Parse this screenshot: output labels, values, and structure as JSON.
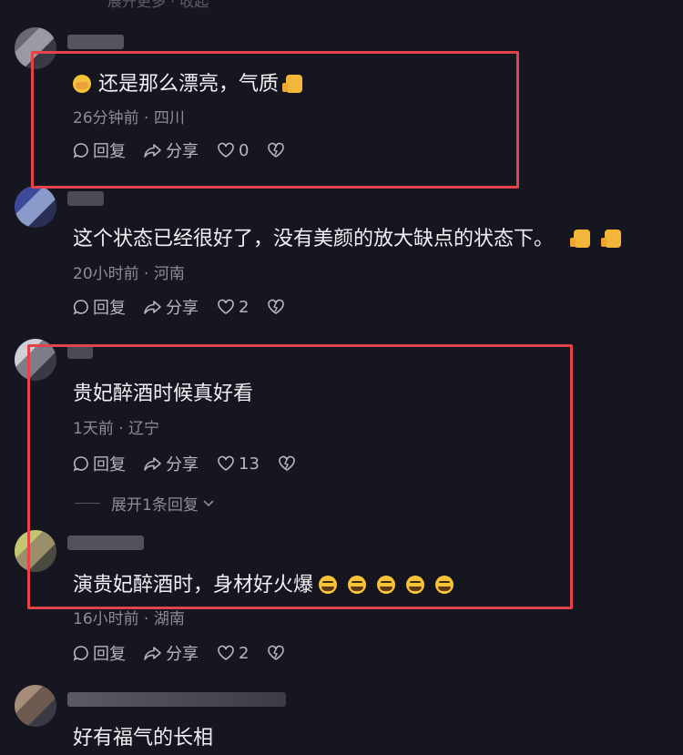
{
  "top_faded": "展开更多 · 收起",
  "comments": [
    {
      "text": "还是那么漂亮，气质",
      "meta": "26分钟前 · 四川",
      "reply": "回复",
      "share": "分享",
      "likes": "0",
      "emoji": [
        "cover-face-icon",
        "thumbs-up-icon"
      ]
    },
    {
      "text": "这个状态已经很好了，没有美颜的放大缺点的状态下。",
      "meta": "20小时前 · 河南",
      "reply": "回复",
      "share": "分享",
      "likes": "2",
      "emoji": [
        "thumbs-up-icon",
        "thumbs-up-icon"
      ]
    },
    {
      "text": "贵妃醉酒时候真好看",
      "meta": "1天前 · 辽宁",
      "reply": "回复",
      "share": "分享",
      "likes": "13",
      "expand": "展开1条回复"
    },
    {
      "text": "演贵妃醉酒时，身材好火爆",
      "meta": "16小时前 · 湖南",
      "reply": "回复",
      "share": "分享",
      "likes": "2",
      "emoji": [
        "crying-laughing-icon",
        "crying-laughing-icon",
        "crying-laughing-icon",
        "crying-laughing-icon",
        "crying-laughing-icon"
      ]
    },
    {
      "text": "好有福气的长相"
    }
  ],
  "colors": {
    "background": "#161620",
    "highlight_border": "#e5434a",
    "meta_text": "#8d8d97"
  }
}
